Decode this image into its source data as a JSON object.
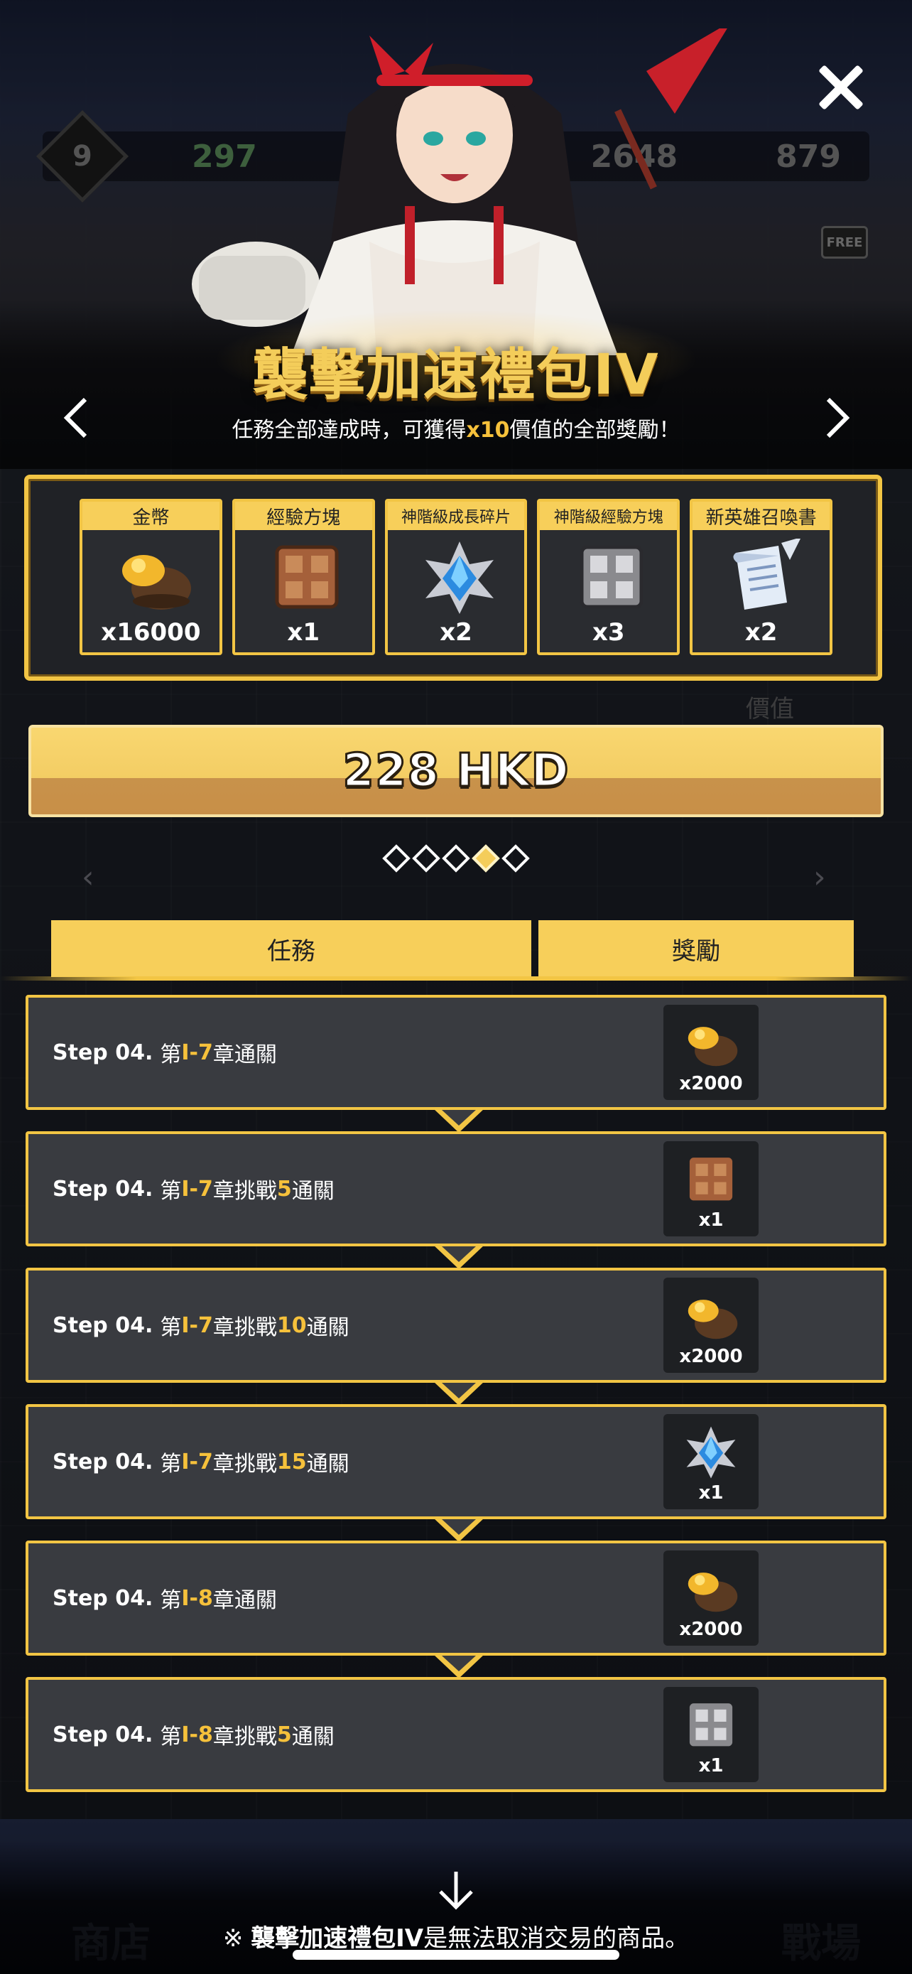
{
  "background": {
    "level": "9",
    "food": "297",
    "gold": "2648",
    "gems": "879",
    "free_badge": "FREE",
    "value_label": "價值",
    "nav_shop": "商店",
    "nav_battle": "戰場"
  },
  "pack": {
    "title": "襲擊加速禮包IV",
    "subtitle_pre": "任務全部達成時，可獲得",
    "subtitle_highlight": "x10",
    "subtitle_post": "價值的全部獎勵！"
  },
  "rewards": [
    {
      "name": "金幣",
      "qty": "x16000",
      "icon": "gold-pouch-icon"
    },
    {
      "name": "經驗方塊",
      "qty": "x1",
      "icon": "exp-cube-icon"
    },
    {
      "name": "神階級成長碎片",
      "qty": "x2",
      "icon": "growth-shard-icon"
    },
    {
      "name": "神階級經驗方塊",
      "qty": "x3",
      "icon": "divine-exp-cube-icon"
    },
    {
      "name": "新英雄召喚書",
      "qty": "x2",
      "icon": "summon-scroll-icon"
    }
  ],
  "price": "228 HKD",
  "pager": {
    "count": 5,
    "active_index": 3
  },
  "tabs": {
    "missions": "任務",
    "rewards": "獎勵"
  },
  "tasks": [
    {
      "step": "Step 04.",
      "pre": "第",
      "chapter": "I-7",
      "mid": "章通關",
      "num": "",
      "post": "",
      "reward_qty": "x2000",
      "reward_icon": "gold-pouch-icon"
    },
    {
      "step": "Step 04.",
      "pre": "第",
      "chapter": "I-7",
      "mid": "章挑戰",
      "num": "5",
      "post": "通關",
      "reward_qty": "x1",
      "reward_icon": "exp-cube-icon"
    },
    {
      "step": "Step 04.",
      "pre": "第",
      "chapter": "I-7",
      "mid": "章挑戰",
      "num": "10",
      "post": "通關",
      "reward_qty": "x2000",
      "reward_icon": "gold-pouch-icon"
    },
    {
      "step": "Step 04.",
      "pre": "第",
      "chapter": "I-7",
      "mid": "章挑戰",
      "num": "15",
      "post": "通關",
      "reward_qty": "x1",
      "reward_icon": "growth-shard-icon"
    },
    {
      "step": "Step 04.",
      "pre": "第",
      "chapter": "I-8",
      "mid": "章通關",
      "num": "",
      "post": "",
      "reward_qty": "x2000",
      "reward_icon": "gold-pouch-icon"
    },
    {
      "step": "Step 04.",
      "pre": "第",
      "chapter": "I-8",
      "mid": "章挑戰",
      "num": "5",
      "post": "通關",
      "reward_qty": "x1",
      "reward_icon": "divine-exp-cube-icon"
    }
  ],
  "footer": {
    "note_pre": "※ ",
    "note_bold": "襲擊加速禮包IV",
    "note_post": "是無法取消交易的商品。"
  },
  "colors": {
    "accent": "#f2c544",
    "highlight": "#f6c13b",
    "panel": "#393b40"
  }
}
